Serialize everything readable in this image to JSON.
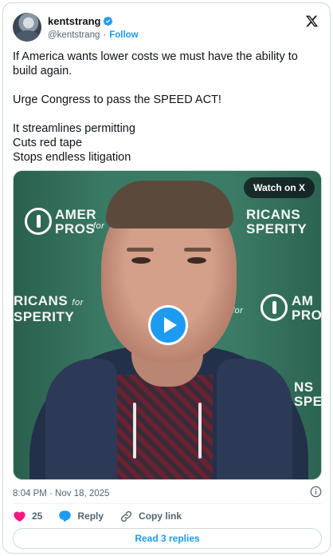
{
  "author": {
    "name": "kentstrang",
    "handle": "@kentstrang",
    "separator": "·",
    "follow_label": "Follow",
    "verified": true
  },
  "tweet": {
    "text": "If America wants lower costs we must have the ability to build again.\n\nUrge Congress to pass the SPEED ACT!\n\nIt streamlines permitting\nCuts red tape\nStops endless litigation"
  },
  "media": {
    "type": "video",
    "watch_label": "Watch on X",
    "backdrop_logo_lines": [
      "AMERICANS",
      "for",
      "PROSPERITY"
    ],
    "logo_fragments": {
      "top_left_1": "AMER",
      "top_left_2": "PROS",
      "top_right_1": "RICANS",
      "top_right_2": "SPERITY",
      "mid_left_1": "RICANS",
      "mid_left_2": "SPERITY",
      "mid_for_left": "for",
      "mid_for_right": "for",
      "mid_right_1": "AM",
      "mid_right_2": "PRO",
      "bottom_right_1": "NS",
      "bottom_right_2": "SPE",
      "top_for": "for"
    }
  },
  "meta": {
    "timestamp": "8:04 PM · Nov 18, 2025"
  },
  "actions": {
    "like_count": "25",
    "reply_label": "Reply",
    "copy_label": "Copy link"
  },
  "replies_button": "Read 3 replies",
  "colors": {
    "accent": "#1d9bf0",
    "like": "#f91880",
    "text": "#0f1419",
    "secondary": "#536471",
    "border": "#cfd9de"
  },
  "icons": [
    "verified-badge-icon",
    "x-logo-icon",
    "info-icon",
    "heart-icon",
    "reply-bubble-icon",
    "link-icon",
    "play-icon"
  ]
}
